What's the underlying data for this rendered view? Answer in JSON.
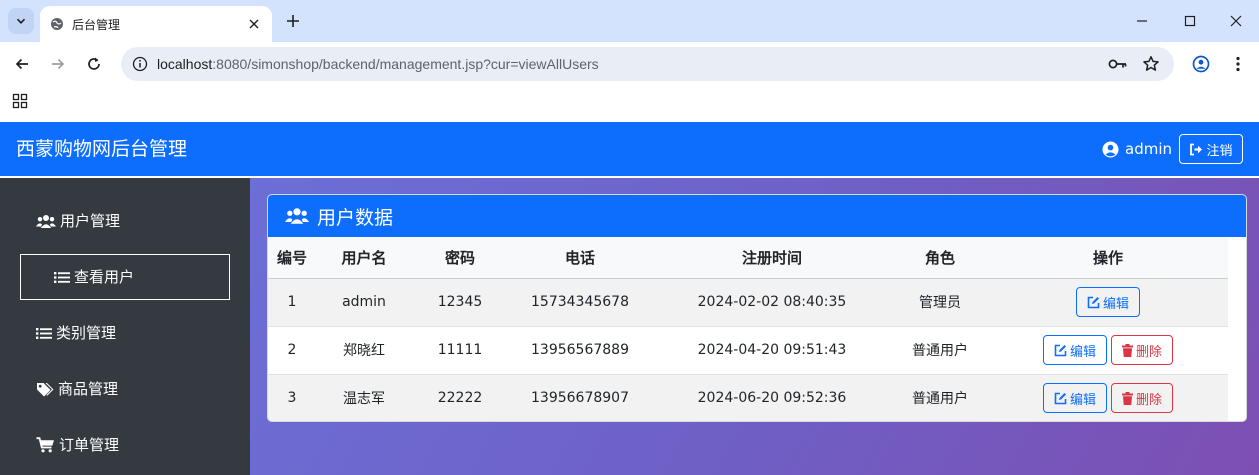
{
  "browser": {
    "tab_title": "后台管理",
    "url_host": "localhost",
    "url_rest": ":8080/simonshop/backend/management.jsp?cur=viewAllUsers"
  },
  "app": {
    "brand": "西蒙购物网后台管理",
    "user_name": "admin",
    "logout_label": "注销",
    "accent_color": "#0d6efd"
  },
  "sidebar": {
    "items": [
      {
        "label": "用户管理",
        "icon": "users-icon"
      },
      {
        "label": "查看用户",
        "icon": "list-icon",
        "active": true
      },
      {
        "label": "类别管理",
        "icon": "list-icon"
      },
      {
        "label": "商品管理",
        "icon": "tags-icon"
      },
      {
        "label": "订单管理",
        "icon": "cart-icon"
      }
    ]
  },
  "card": {
    "title": "用户数据",
    "columns": [
      "编号",
      "用户名",
      "密码",
      "电话",
      "注册时间",
      "角色",
      "操作"
    ],
    "rows": [
      {
        "id": "1",
        "username": "admin",
        "password": "12345",
        "phone": "15734345678",
        "registered": "2024-02-02 08:40:35",
        "role": "管理员"
      },
      {
        "id": "2",
        "username": "郑晓红",
        "password": "11111",
        "phone": "13956567889",
        "registered": "2024-04-20 09:51:43",
        "role": "普通用户"
      },
      {
        "id": "3",
        "username": "温志军",
        "password": "22222",
        "phone": "13956678907",
        "registered": "2024-06-20 09:52:36",
        "role": "普通用户"
      }
    ],
    "edit_label": "编辑",
    "delete_label": "删除"
  }
}
